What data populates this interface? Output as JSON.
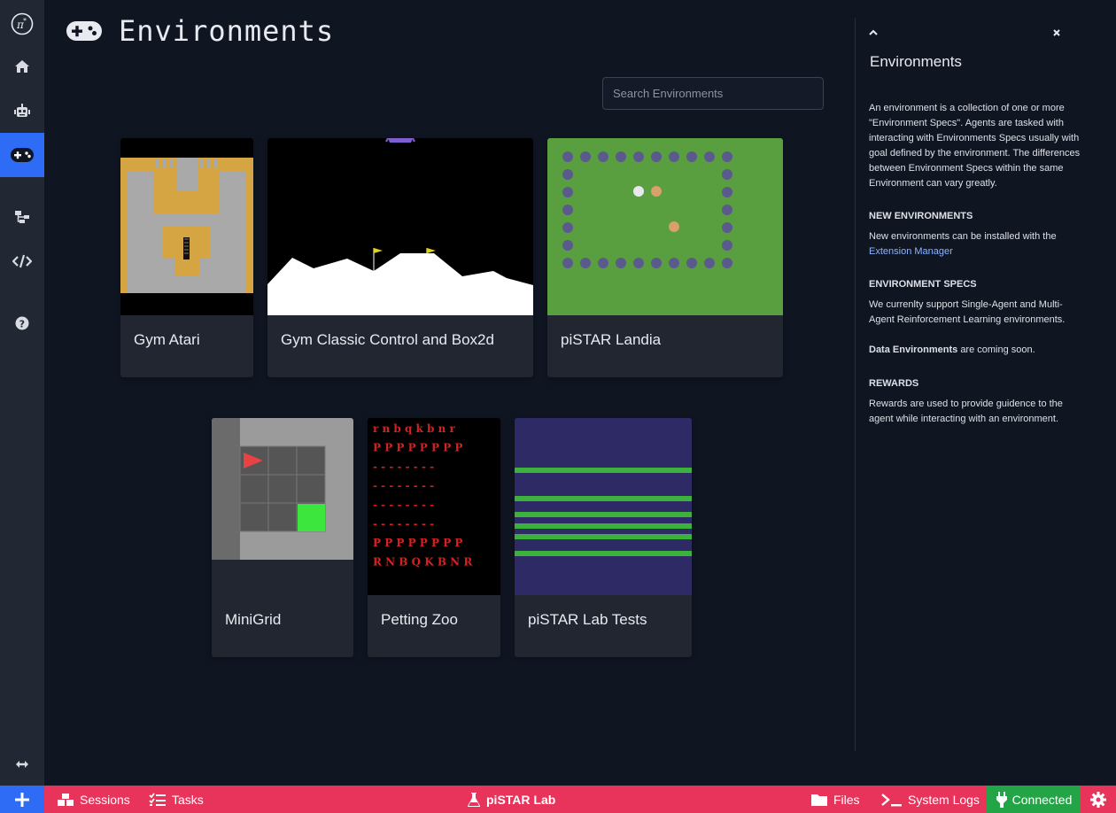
{
  "page": {
    "title": "Environments"
  },
  "search": {
    "placeholder": "Search Environments"
  },
  "cards": [
    {
      "label": "Gym Atari"
    },
    {
      "label": "Gym Classic Control and Box2d"
    },
    {
      "label": "piSTAR Landia"
    },
    {
      "label": "MiniGrid"
    },
    {
      "label": "Petting Zoo"
    },
    {
      "label": "piSTAR Lab Tests"
    }
  ],
  "sidebar": {
    "items": [
      "pistar-logo-icon",
      "home-icon",
      "robot-icon",
      "gamepad-icon",
      "sitemap-icon",
      "code-icon",
      "help-icon",
      "expand-icon"
    ]
  },
  "panel": {
    "title": "Environments",
    "intro": "An environment is a collection of one or more \"Environment Specs\". Agents are tasked with interacting with Environments Specs usually with goal defined by the environment. The differences between Environment Specs within the same Environment can vary greatly.",
    "new_env_heading": "NEW ENVIRONMENTS",
    "new_env_text": "New environments can be installed with the",
    "new_env_link": "Extension Manager",
    "specs_heading": "ENVIRONMENT SPECS",
    "specs_text": "We currenlty support Single-Agent and Multi-Agent Reinforcement Learning environments.",
    "data_env_bold": "Data Environments",
    "data_env_text": "are coming soon.",
    "rewards_heading": "REWARDS",
    "rewards_text": "Rewards are used to provide guidence to the agent while interacting with an environment."
  },
  "petting_zoo_rows": [
    "r n b q k b n r",
    "P P P P P P P P",
    "- - - - - - - -",
    "- - - - - - - -",
    "- - - - - - - -",
    "- - - - - - - -",
    "P P P P P P P P",
    "R N B Q K B N R"
  ],
  "bottombar": {
    "sessions": "Sessions",
    "tasks": "Tasks",
    "app": "piSTAR Lab",
    "files": "Files",
    "logs": "System Logs",
    "status": "Connected"
  },
  "colors": {
    "accent": "#2f6cf5",
    "bottombar": "#e8345b",
    "connected": "#22a447",
    "background": "#101522"
  }
}
